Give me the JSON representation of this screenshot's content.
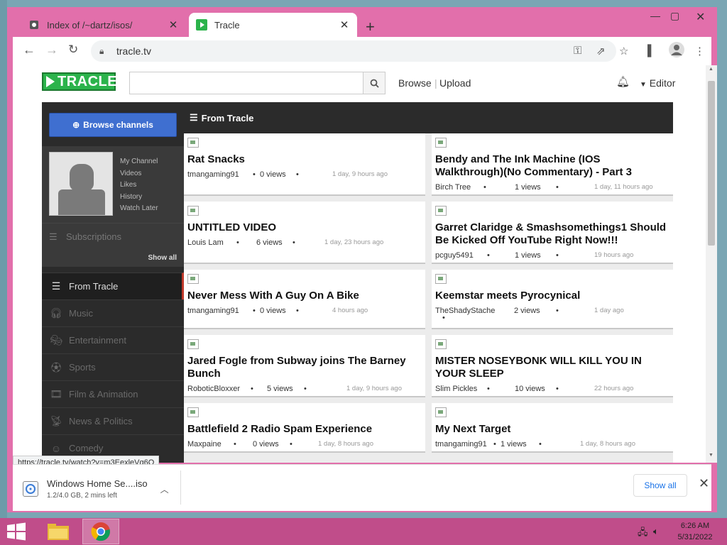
{
  "browser": {
    "tabs": [
      {
        "title": "Index of /~dartz/isos/",
        "icon": "web-icon"
      },
      {
        "title": "Tracle",
        "icon": "tracle-icon"
      }
    ],
    "url": "tracle.tv",
    "status_url": "https://tracle.tv/watch?v=m3EexleVq6Q"
  },
  "site": {
    "logo": "TRACLE",
    "search_placeholder": "",
    "nav": {
      "browse": "Browse",
      "separator": "|",
      "upload": "Upload",
      "editor": "Editor"
    }
  },
  "sidebar": {
    "browse_channels": "Browse channels",
    "profile_links": [
      "My Channel",
      "Videos",
      "Likes",
      "History",
      "Watch Later"
    ],
    "subscriptions": "Subscriptions",
    "show_all": "Show all",
    "categories": [
      {
        "label": "From Tracle",
        "icon": "list-icon",
        "active": true
      },
      {
        "label": "Music",
        "icon": "headphones-icon"
      },
      {
        "label": "Entertainment",
        "icon": "masks-icon"
      },
      {
        "label": "Sports",
        "icon": "ball-icon"
      },
      {
        "label": "Film & Animation",
        "icon": "film-icon"
      },
      {
        "label": "News & Politics",
        "icon": "broadcast-icon"
      },
      {
        "label": "Comedy",
        "icon": "comedy-icon"
      }
    ]
  },
  "main": {
    "heading": "From Tracle",
    "videos": [
      {
        "title": "Rat Snacks",
        "author": "tmangaming91",
        "views": "0 views",
        "ago": "1 day, 9 hours ago"
      },
      {
        "title": "Bendy and The Ink Machine (IOS Walkthrough)(No Commentary) - Part 3",
        "author": "Birch Tree",
        "views": "1 views",
        "ago": "1 day, 11 hours ago"
      },
      {
        "title": "UNTITLED VIDEO",
        "author": "Louis Lam",
        "views": "6 views",
        "ago": "1 day, 23 hours ago"
      },
      {
        "title": "Garret Claridge & Smashsomethings1 Should Be Kicked Off YouTube Right Now!!!",
        "author": "pcguy5491",
        "views": "1 views",
        "ago": "19 hours ago"
      },
      {
        "title": "Never Mess With A Guy On A Bike",
        "author": "tmangaming91",
        "views": "0 views",
        "ago": "4 hours ago"
      },
      {
        "title": "Keemstar meets Pyrocynical",
        "author": "TheShadyStache",
        "views": "2 views",
        "ago": "1 day ago"
      },
      {
        "title": "Jared Fogle from Subway joins The Barney Bunch",
        "author": "RoboticBloxxer",
        "views": "5 views",
        "ago": "1 day, 9 hours ago"
      },
      {
        "title": "MISTER NOSEYBONK WILL KILL YOU IN YOUR SLEEP",
        "author": "Slim Pickles",
        "views": "10 views",
        "ago": "22 hours ago"
      },
      {
        "title": "Battlefield 2 Radio Spam Experience",
        "author": "Maxpaine",
        "views": "0 views",
        "ago": "1 day, 8 hours ago"
      },
      {
        "title": "My Next Target",
        "author": "tmangaming91",
        "views": "1 views",
        "ago": "1 day, 8 hours ago"
      }
    ],
    "bullet": "•"
  },
  "downloads": {
    "filename": "Windows Home Se....iso",
    "progress": "1.2/4.0 GB, 2 mins left",
    "show_all": "Show all"
  },
  "taskbar": {
    "time": "6:26 AM",
    "date": "5/31/2022"
  },
  "colors": {
    "accent": "#e26fab",
    "logo_green": "#2bb34b",
    "taskbar": "#c04d8a",
    "link_blue": "#1a73e8"
  }
}
